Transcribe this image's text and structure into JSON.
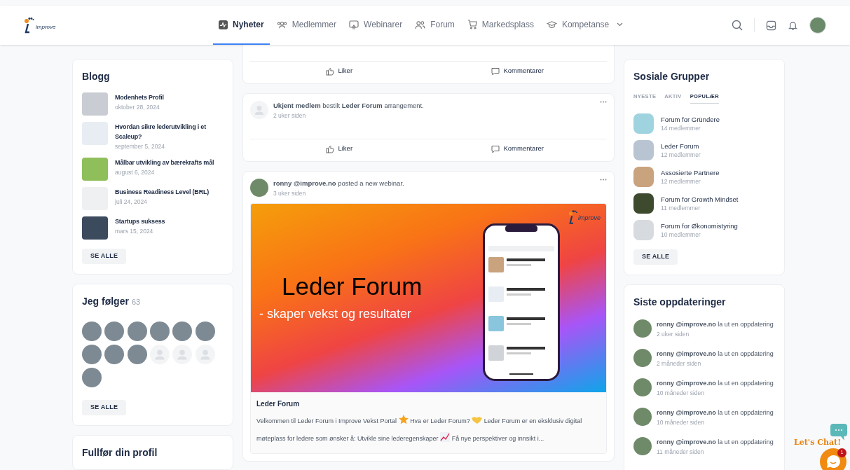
{
  "header": {
    "logo": "improve",
    "nav": [
      {
        "label": "Nyheter",
        "selected": true,
        "has_menu": false
      },
      {
        "label": "Medlemmer",
        "selected": false,
        "has_menu": false
      },
      {
        "label": "Webinarer",
        "selected": false,
        "has_menu": false
      },
      {
        "label": "Forum",
        "selected": false,
        "has_menu": false
      },
      {
        "label": "Markedsplass",
        "selected": false,
        "has_menu": false
      },
      {
        "label": "Kompetanse",
        "selected": false,
        "has_menu": true
      }
    ]
  },
  "left": {
    "blog": {
      "title": "Blogg",
      "items": [
        {
          "title": "Modenhets Profil",
          "date": "oktober 28, 2024"
        },
        {
          "title": "Hvordan sikre lederutvikling i et Scaleup?",
          "date": "september 5, 2024"
        },
        {
          "title": "Målbar utvikling av bærekrafts mål",
          "date": "august 6, 2024"
        },
        {
          "title": "Business Readiness Level (BRL)",
          "date": "juli 24, 2024"
        },
        {
          "title": "Startups suksess",
          "date": "mars 15, 2024"
        }
      ],
      "button": "SE ALLE"
    },
    "following": {
      "title": "Jeg følger",
      "count": "63",
      "people": [
        {
          "kind": "photo"
        },
        {
          "kind": "photo"
        },
        {
          "kind": "photo"
        },
        {
          "kind": "photo"
        },
        {
          "kind": "photo"
        },
        {
          "kind": "photo"
        },
        {
          "kind": "photo"
        },
        {
          "kind": "photo"
        },
        {
          "kind": "photo"
        },
        {
          "kind": "placeholder"
        },
        {
          "kind": "placeholder"
        },
        {
          "kind": "placeholder"
        },
        {
          "kind": "photo"
        }
      ],
      "button": "SE ALLE"
    },
    "profile": {
      "title": "Fullfør din profil"
    }
  },
  "feed": [
    {
      "kind": "actions",
      "actions": [
        "Liker",
        "Kommentarer"
      ]
    },
    {
      "kind": "activity",
      "avatar_photo": false,
      "text": "**Ukjent medlem** bestilt **Leder Forum** arrangement.",
      "time": "2 uker siden",
      "actions": [
        "Liker",
        "Kommentarer"
      ]
    },
    {
      "kind": "webinar",
      "avatar_photo": true,
      "text": "**ronny @improve.no** posted a new webinar.",
      "time": "3 uker siden",
      "banner": {
        "title": "Leder Forum",
        "subtitle": "- skaper vekst og resultater",
        "logo": "improve"
      },
      "title": "Leder Forum",
      "description": [
        {
          "kind": "text",
          "text": "Velkommen til Leder Forum i Improve Vekst Portal"
        },
        {
          "kind": "star"
        },
        {
          "kind": "text",
          "text": "Hva er Leder Forum?"
        },
        {
          "kind": "handshake"
        },
        {
          "kind": "text",
          "text": "Leder Forum er en eksklusiv digital møteplass for ledere som ønsker å: Utvikle sine lederegenskaper"
        },
        {
          "kind": "chart"
        },
        {
          "kind": "text",
          "text": "Få nye perspektiver og innsikt i..."
        }
      ]
    }
  ],
  "right": {
    "groups": {
      "title": "Sosiale Grupper",
      "tabs": [
        {
          "label": "NYESTE",
          "selected": false
        },
        {
          "label": "AKTIV",
          "selected": false
        },
        {
          "label": "POPULÆR",
          "selected": true
        }
      ],
      "items": [
        {
          "name": "Forum for Gründere",
          "members": "14 medlemmer"
        },
        {
          "name": "Leder Forum",
          "members": "12 medlemmer"
        },
        {
          "name": "Assosierte Partnere",
          "members": "12 medlemmer"
        },
        {
          "name": "Forum for Growth Mindset",
          "members": "11 medlemmer"
        },
        {
          "name": "Forum for Økonomistyring",
          "members": "10 medlemmer"
        }
      ],
      "button": "SE ALLE"
    },
    "updates": {
      "title": "Siste oppdateringer",
      "items": [
        {
          "text": "**ronny @improve.no** la ut en oppdatering",
          "time": "2 uker siden"
        },
        {
          "text": "**ronny @improve.no** la ut en oppdatering",
          "time": "2 måneder siden"
        },
        {
          "text": "**ronny @improve.no** la ut en oppdatering",
          "time": "10 måneder siden"
        },
        {
          "text": "**ronny @improve.no** la ut en oppdatering",
          "time": "10 måneder siden"
        },
        {
          "text": "**ronny @improve.no** la ut en oppdatering",
          "time": "11 måneder siden"
        }
      ]
    }
  },
  "chat": {
    "label": "Let's Chat!",
    "badge": "1"
  }
}
